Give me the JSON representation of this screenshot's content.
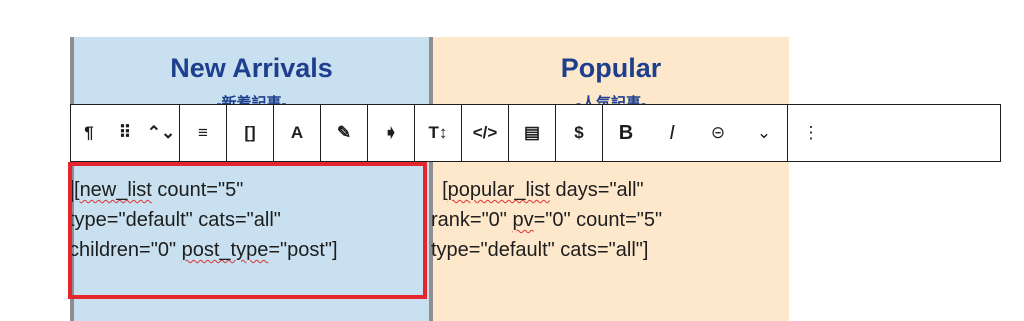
{
  "columns": {
    "left": {
      "title": "New Arrivals",
      "subtitle": "-新着記事-"
    },
    "right": {
      "title": "Popular",
      "subtitle": "-人気記事-"
    }
  },
  "toolbar": {
    "buttons": [
      {
        "icon": "paragraph-icon",
        "glyph": "¶"
      },
      {
        "icon": "drag-handle-icon",
        "glyph": "⠿"
      },
      {
        "icon": "move-up-down-icon",
        "glyph": "⌃⌄"
      },
      {
        "icon": "align-icon",
        "glyph": "≡"
      },
      {
        "icon": "brackets-icon",
        "glyph": "[]"
      },
      {
        "icon": "font-icon",
        "glyph": "A"
      },
      {
        "icon": "highlighter-icon",
        "glyph": "✎"
      },
      {
        "icon": "tag-icon",
        "glyph": "➧"
      },
      {
        "icon": "text-size-icon",
        "glyph": "T↕"
      },
      {
        "icon": "code-icon",
        "glyph": "</>"
      },
      {
        "icon": "document-icon",
        "glyph": "▤"
      },
      {
        "icon": "dollar-icon",
        "glyph": "$"
      },
      {
        "icon": "bold-icon",
        "glyph": "B"
      },
      {
        "icon": "italic-icon",
        "glyph": "I"
      },
      {
        "icon": "link-icon",
        "glyph": "⊝"
      },
      {
        "icon": "chevron-down-icon",
        "glyph": "⌄"
      },
      {
        "icon": "more-options-icon",
        "glyph": "⋮"
      }
    ]
  },
  "shortcodes": {
    "left": {
      "l1_a": "[",
      "l1_b": "new_list",
      "l1_c": " count=\"5\"",
      "l2": "type=\"default\" cats=\"all\"",
      "l3_a": "children=\"0\" ",
      "l3_b": "post_type",
      "l3_c": "=\"post\"]"
    },
    "right": {
      "l1_a": "  [",
      "l1_b": "popular_list",
      "l1_c": " days=\"all\"",
      "l2_a": "rank=\"0\" ",
      "l2_b": "pv",
      "l2_c": "=\"0\" count=\"5\"",
      "l3": "type=\"default\" cats=\"all\"]"
    }
  },
  "colors": {
    "left_bg": "#c8e0ef",
    "right_bg": "#fde8cc",
    "heading": "#1d3f8d",
    "highlight_box": "#e4272f"
  }
}
